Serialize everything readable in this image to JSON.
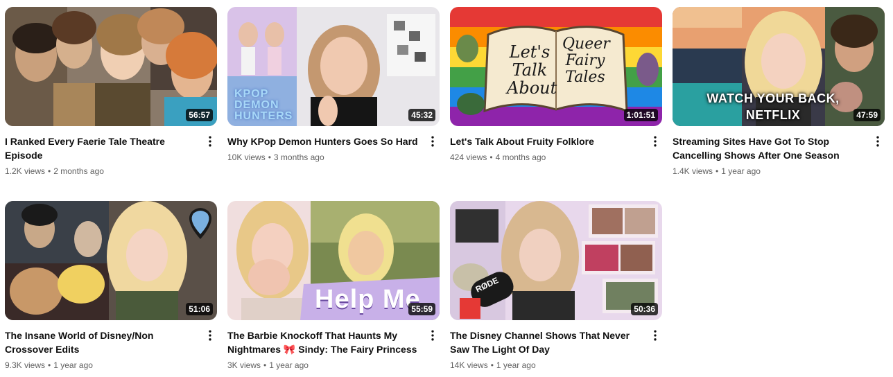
{
  "videos": [
    {
      "title": "I Ranked Every Faerie Tale Theatre Episode",
      "duration": "56:57",
      "views": "1.2K views",
      "age": "2 months ago"
    },
    {
      "title": "Why KPop Demon Hunters Goes So Hard",
      "duration": "45:32",
      "views": "10K views",
      "age": "3 months ago",
      "thumb_text": "KPOP DEMON HUNTERS"
    },
    {
      "title": "Let's Talk About Fruity Folklore",
      "duration": "1:01:51",
      "views": "424 views",
      "age": "4 months ago",
      "thumb_text_left": "Let's Talk About",
      "thumb_text_right": "Queer Fairy Tales"
    },
    {
      "title": "Streaming Sites Have Got To Stop Cancelling Shows After One Season",
      "duration": "47:59",
      "views": "1.4K views",
      "age": "1 year ago",
      "thumb_text": "WATCH YOUR BACK, NETFLIX"
    },
    {
      "title": "The Insane World of Disney/Non Crossover Edits",
      "duration": "51:06",
      "views": "9.3K views",
      "age": "1 year ago"
    },
    {
      "title": "The Barbie Knockoff That Haunts My Nightmares 🎀 Sindy: The Fairy Princess",
      "duration": "55:59",
      "views": "3K views",
      "age": "1 year ago",
      "thumb_text": "Help Me"
    },
    {
      "title": "The Disney Channel Shows That Never Saw The Light Of Day",
      "duration": "50:36",
      "views": "14K views",
      "age": "1 year ago",
      "thumb_text": "RØDE"
    }
  ],
  "separator": "•",
  "icons": {
    "menu": "more-vert-icon"
  }
}
